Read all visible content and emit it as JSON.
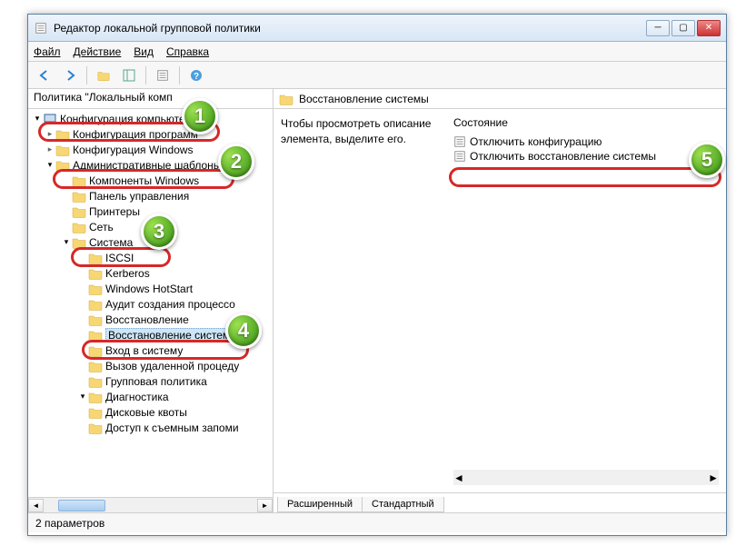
{
  "window": {
    "title": "Редактор локальной групповой политики"
  },
  "menubar": {
    "file": "Файл",
    "action": "Действие",
    "view": "Вид",
    "help": "Справка"
  },
  "tree": {
    "header": "Политика \"Локальный комп",
    "root": "Конфигурация компьютера",
    "items": [
      "Конфигурация программ",
      "Конфигурация Windows",
      "Административные шаблоны",
      "Компоненты Windows",
      "Панель управления",
      "Принтеры",
      "Сеть",
      "Система",
      "ISCSI",
      "Kerberos",
      "Windows HotStart",
      "Аудит создания процессо",
      "Восстановление",
      "Восстановление системы",
      "Вход в систему",
      "Вызов удаленной процеду",
      "Групповая политика",
      "Диагностика",
      "Дисковые квоты",
      "Доступ к съемным запоми"
    ],
    "selected_index": 13
  },
  "rightpanel": {
    "title": "Восстановление системы",
    "description": "Чтобы просмотреть описание элемента, выделите его.",
    "column": "Состояние",
    "items": [
      "Отключить конфигурацию",
      "Отключить восстановление системы"
    ]
  },
  "tabs": {
    "extended": "Расширенный",
    "standard": "Стандартный"
  },
  "statusbar": {
    "text": "2 параметров"
  },
  "badges": [
    "1",
    "2",
    "3",
    "4",
    "5"
  ]
}
